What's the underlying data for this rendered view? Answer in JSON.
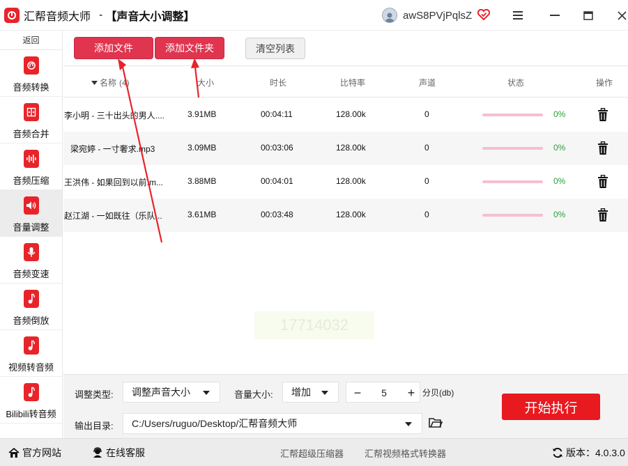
{
  "window": {
    "app_name": "汇帮音频大师",
    "separator": "-",
    "module_title": "【声音大小调整】",
    "username": "awS8PVjPqlsZ"
  },
  "sidebar": {
    "back_label": "返回",
    "items": [
      {
        "label": "音频转换",
        "icon": "audio-convert-icon"
      },
      {
        "label": "音频合并",
        "icon": "audio-merge-icon"
      },
      {
        "label": "音频压缩",
        "icon": "audio-compress-icon"
      },
      {
        "label": "音量调整",
        "icon": "volume-icon",
        "active": true
      },
      {
        "label": "音频变速",
        "icon": "microphone-icon"
      },
      {
        "label": "音频倒放",
        "icon": "music-note-icon"
      },
      {
        "label": "视频转音频",
        "icon": "music-note-icon"
      },
      {
        "label": "Bilibili转音频",
        "icon": "music-note-icon"
      }
    ]
  },
  "toolbar": {
    "add_file": "添加文件",
    "add_folder": "添加文件夹",
    "clear_list": "清空列表"
  },
  "table": {
    "headers": {
      "name": "名称",
      "name_suffix": "(4)",
      "size": "大小",
      "duration": "时长",
      "bitrate": "比特率",
      "channels": "声道",
      "status": "状态",
      "action": "操作"
    },
    "rows": [
      {
        "name": "李小明 - 三十出头的男人....",
        "size": "3.91MB",
        "duration": "00:04:11",
        "bitrate": "128.00k",
        "channels": "0",
        "progress_pct": "0%"
      },
      {
        "name": "梁宛婷 - 一寸奢求.mp3",
        "size": "3.09MB",
        "duration": "00:03:06",
        "bitrate": "128.00k",
        "channels": "0",
        "progress_pct": "0%"
      },
      {
        "name": "王洪伟 - 如果回到以前.m...",
        "size": "3.88MB",
        "duration": "00:04:01",
        "bitrate": "128.00k",
        "channels": "0",
        "progress_pct": "0%"
      },
      {
        "name": "赵江湖 - 一如既往（乐队...",
        "size": "3.61MB",
        "duration": "00:03:48",
        "bitrate": "128.00k",
        "channels": "0",
        "progress_pct": "0%"
      }
    ]
  },
  "watermark": {
    "text": "17714032"
  },
  "settings": {
    "adjust_type_label": "调整类型:",
    "adjust_type_value": "调整声音大小",
    "volume_label": "音量大小:",
    "volume_mode_value": "增加",
    "volume_minus": "−",
    "volume_value": "5",
    "volume_plus": "+",
    "unit_label": "分贝(db)",
    "output_label": "输出目录:",
    "output_path": "C:/Users/ruguo/Desktop/汇帮音频大师",
    "start_button": "开始执行"
  },
  "footer": {
    "website": "官方网站",
    "support": "在线客服",
    "link_compressor": "汇帮超级压缩器",
    "link_video_converter": "汇帮视频格式转换器",
    "version_label": "版本：",
    "version_value": "4.0.3.0"
  },
  "colors": {
    "brand_red": "#e8242b",
    "primary_button": "#e0344f",
    "start_button": "#e8191f",
    "progress_track": "#f5bfd0",
    "percent_green": "#2a9d3a"
  }
}
